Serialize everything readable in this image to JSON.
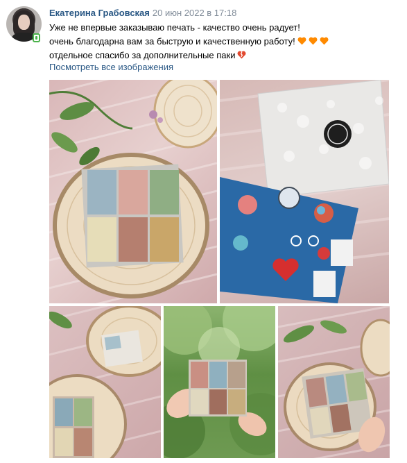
{
  "author": {
    "name": "Екатерина Грабовская",
    "date": "20 июн 2022 в 17:18"
  },
  "post": {
    "lines": [
      "Уже не впервые заказываю печать - качество очень радует!",
      "очень благодарна вам за быструю и качественную работу!",
      "отдельное спасибо за дополнительные паки"
    ],
    "show_all_images": "Посмотреть все изображения"
  },
  "photos": [
    {
      "name": "photo-wood-slice-prints"
    },
    {
      "name": "photo-sticker-sheet"
    },
    {
      "name": "photo-prints-small-1"
    },
    {
      "name": "photo-prints-in-hand"
    },
    {
      "name": "photo-prints-small-2"
    }
  ],
  "colors": {
    "link": "#2a5885",
    "date": "#818c99",
    "heart_orange": "#ff8a00",
    "heart_broken": "#e2492f"
  },
  "icons": [
    "avatar",
    "online-mobile-icon",
    "orange-heart-icon",
    "broken-heart-icon"
  ]
}
